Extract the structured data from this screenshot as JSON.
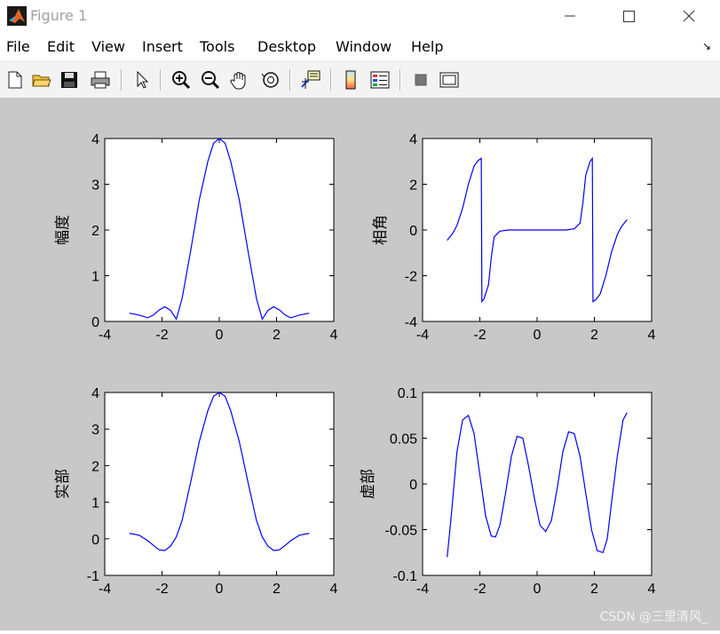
{
  "window": {
    "title": "Figure 1",
    "minimize_glyph": "—",
    "maximize_glyph": "☐",
    "close_glyph": "✕"
  },
  "menu": {
    "items": [
      "File",
      "Edit",
      "View",
      "Insert",
      "Tools",
      "Desktop",
      "Window",
      "Help"
    ],
    "dock_arrow": "↘"
  },
  "toolbar": {
    "icons": [
      "new-figure-icon",
      "open-file-icon",
      "save-icon",
      "print-icon",
      "select-arrow-icon",
      "zoom-in-icon",
      "zoom-out-icon",
      "pan-hand-icon",
      "rotate-3d-icon",
      "data-cursor-icon",
      "colorbar-icon",
      "legend-icon",
      "hide-plot-tools-icon",
      "show-plot-tools-icon"
    ]
  },
  "colors": {
    "line": "#0000ff",
    "figure_bg": "#c8c8c8",
    "axes_bg": "#ffffff"
  },
  "watermark": "CSDN @三里清风_",
  "chart_data": [
    {
      "type": "line",
      "ylabel": "幅度",
      "xlim": [
        -4,
        4
      ],
      "ylim": [
        0,
        4
      ],
      "xticks": [
        "-4",
        "-2",
        "0",
        "2",
        "4"
      ],
      "yticks": [
        "0",
        "1",
        "2",
        "3",
        "4"
      ],
      "x": [
        -3.14,
        -2.8,
        -2.5,
        -2.3,
        -2.1,
        -1.9,
        -1.7,
        -1.5,
        -1.3,
        -1.0,
        -0.7,
        -0.4,
        -0.2,
        0,
        0.2,
        0.4,
        0.7,
        1.0,
        1.3,
        1.5,
        1.7,
        1.9,
        2.1,
        2.3,
        2.5,
        2.8,
        3.14
      ],
      "y": [
        0.18,
        0.14,
        0.08,
        0.14,
        0.25,
        0.32,
        0.24,
        0.05,
        0.5,
        1.55,
        2.65,
        3.5,
        3.9,
        4.0,
        3.9,
        3.5,
        2.65,
        1.55,
        0.5,
        0.05,
        0.24,
        0.32,
        0.25,
        0.14,
        0.08,
        0.14,
        0.18
      ]
    },
    {
      "type": "line",
      "ylabel": "相角",
      "xlim": [
        -4,
        4
      ],
      "ylim": [
        -4,
        4
      ],
      "xticks": [
        "-4",
        "-2",
        "0",
        "2",
        "4"
      ],
      "yticks": [
        "-4",
        "-2",
        "0",
        "2",
        "4"
      ],
      "x": [
        -3.14,
        -2.95,
        -2.8,
        -2.6,
        -2.4,
        -2.2,
        -2.05,
        -1.95,
        -1.93,
        -1.85,
        -1.7,
        -1.6,
        -1.5,
        -1.3,
        -1.0,
        0,
        1.0,
        1.3,
        1.5,
        1.6,
        1.7,
        1.85,
        1.93,
        1.95,
        2.05,
        2.2,
        2.4,
        2.6,
        2.8,
        2.95,
        3.14
      ],
      "y": [
        -0.45,
        -0.15,
        0.2,
        0.95,
        2.0,
        2.8,
        3.05,
        3.13,
        -3.13,
        -3.0,
        -2.4,
        -1.2,
        -0.3,
        -0.05,
        0,
        0,
        0,
        0.05,
        0.3,
        1.2,
        2.4,
        3.0,
        3.13,
        -3.13,
        -3.05,
        -2.8,
        -2.0,
        -0.95,
        -0.2,
        0.15,
        0.45
      ]
    },
    {
      "type": "line",
      "ylabel": "实部",
      "xlim": [
        -4,
        4
      ],
      "ylim": [
        -1,
        4
      ],
      "xticks": [
        "-4",
        "-2",
        "0",
        "2",
        "4"
      ],
      "yticks": [
        "-1",
        "0",
        "1",
        "2",
        "3",
        "4"
      ],
      "x": [
        -3.14,
        -2.8,
        -2.5,
        -2.3,
        -2.1,
        -1.9,
        -1.7,
        -1.5,
        -1.3,
        -1.0,
        -0.7,
        -0.4,
        -0.2,
        0,
        0.2,
        0.4,
        0.7,
        1.0,
        1.3,
        1.5,
        1.7,
        1.9,
        2.1,
        2.3,
        2.5,
        2.8,
        3.14
      ],
      "y": [
        0.15,
        0.1,
        -0.05,
        -0.18,
        -0.3,
        -0.32,
        -0.2,
        0.05,
        0.5,
        1.55,
        2.65,
        3.5,
        3.9,
        4.0,
        3.9,
        3.5,
        2.65,
        1.55,
        0.5,
        0.05,
        -0.2,
        -0.32,
        -0.3,
        -0.18,
        -0.05,
        0.1,
        0.15
      ]
    },
    {
      "type": "line",
      "ylabel": "虚部",
      "xlim": [
        -4,
        4
      ],
      "ylim": [
        -0.1,
        0.1
      ],
      "xticks": [
        "-4",
        "-2",
        "0",
        "2",
        "4"
      ],
      "yticks": [
        "-0.1",
        "-0.05",
        "0",
        "0.05",
        "0.1"
      ],
      "x": [
        -3.14,
        -3.0,
        -2.8,
        -2.6,
        -2.4,
        -2.2,
        -2.0,
        -1.8,
        -1.6,
        -1.45,
        -1.3,
        -1.1,
        -0.9,
        -0.7,
        -0.5,
        -0.3,
        -0.1,
        0.1,
        0.3,
        0.5,
        0.7,
        0.9,
        1.1,
        1.3,
        1.5,
        1.7,
        1.9,
        2.1,
        2.3,
        2.45,
        2.6,
        2.8,
        3.0,
        3.14
      ],
      "y": [
        -0.08,
        -0.035,
        0.035,
        0.07,
        0.075,
        0.055,
        0.01,
        -0.035,
        -0.057,
        -0.058,
        -0.045,
        -0.01,
        0.03,
        0.052,
        0.05,
        0.02,
        -0.015,
        -0.045,
        -0.052,
        -0.04,
        -0.005,
        0.035,
        0.057,
        0.055,
        0.03,
        -0.01,
        -0.05,
        -0.073,
        -0.075,
        -0.06,
        -0.02,
        0.03,
        0.07,
        0.078
      ]
    }
  ]
}
